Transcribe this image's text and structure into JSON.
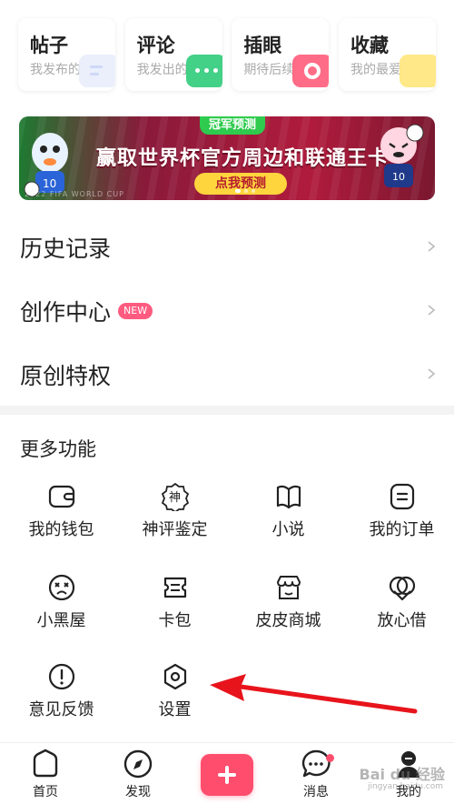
{
  "quick_cards": [
    {
      "title": "帖子",
      "subtitle": "我发布的"
    },
    {
      "title": "评论",
      "subtitle": "我发出的"
    },
    {
      "title": "插眼",
      "subtitle": "期待后续"
    },
    {
      "title": "收藏",
      "subtitle": "我的最爱"
    }
  ],
  "banner": {
    "tag": "冠军预测",
    "headline": "赢取世界杯官方周边和联通王卡",
    "cta": "点我预测",
    "footer_text": "2022 FIFA WORLD CUP"
  },
  "menu": [
    {
      "label": "历史记录"
    },
    {
      "label": "创作中心",
      "badge": "NEW"
    },
    {
      "label": "原创特权"
    }
  ],
  "more_section": {
    "title": "更多功能",
    "items": [
      {
        "label": "我的钱包",
        "icon": "wallet-icon"
      },
      {
        "label": "神评鉴定",
        "icon": "divine-review-icon",
        "glyph": "神"
      },
      {
        "label": "小说",
        "icon": "book-icon"
      },
      {
        "label": "我的订单",
        "icon": "order-icon"
      },
      {
        "label": "小黑屋",
        "icon": "dizzy-face-icon"
      },
      {
        "label": "卡包",
        "icon": "card-pack-icon"
      },
      {
        "label": "皮皮商城",
        "icon": "shop-icon"
      },
      {
        "label": "放心借",
        "icon": "loan-icon"
      },
      {
        "label": "意见反馈",
        "icon": "feedback-icon"
      },
      {
        "label": "设置",
        "icon": "settings-icon"
      }
    ]
  },
  "tabbar": {
    "tabs": [
      {
        "label": "首页",
        "icon": "home-icon"
      },
      {
        "label": "发现",
        "icon": "compass-icon"
      },
      {
        "label": "",
        "icon": "plus-icon"
      },
      {
        "label": "消息",
        "icon": "message-icon",
        "has_dot": true
      },
      {
        "label": "我的",
        "icon": "avatar-icon"
      }
    ]
  },
  "watermark": {
    "text": "Bai du 经验",
    "sub": "jingyan.baidu.com"
  },
  "colors": {
    "accent": "#ff4d6d",
    "arrow": "#e8141c",
    "banner_cta": "#ffd53d"
  }
}
